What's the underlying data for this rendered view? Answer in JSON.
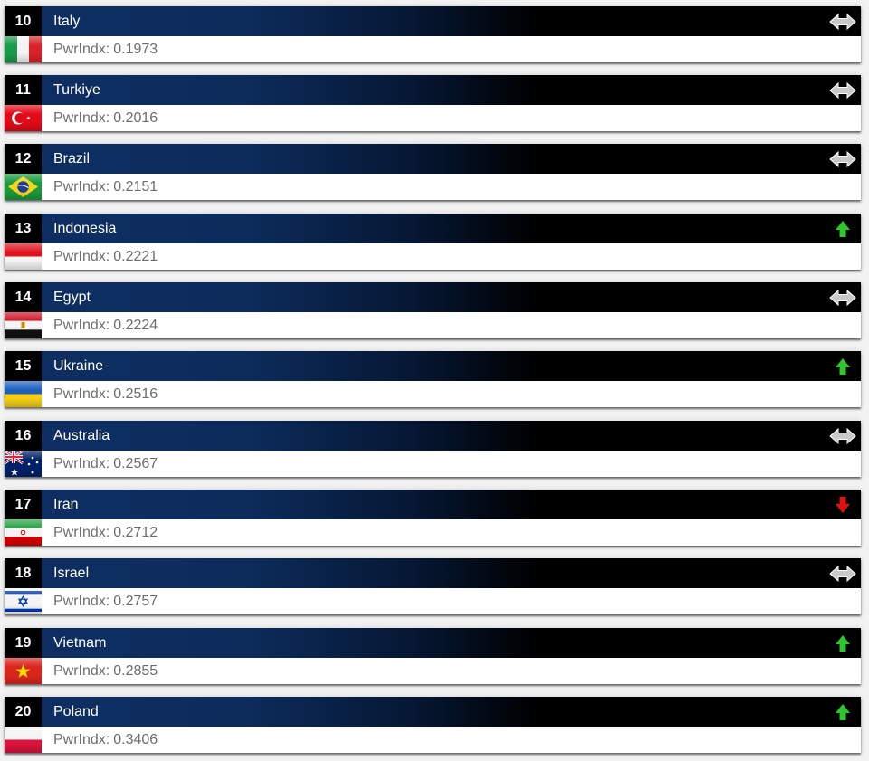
{
  "rankings": [
    {
      "rank": "10",
      "country": "Italy",
      "pwr_label": "PwrIndx:",
      "pwr_value": "0.1973",
      "trend": "same",
      "flag": "flag-italy"
    },
    {
      "rank": "11",
      "country": "Turkiye",
      "pwr_label": "PwrIndx:",
      "pwr_value": "0.2016",
      "trend": "same",
      "flag": "flag-turkiye"
    },
    {
      "rank": "12",
      "country": "Brazil",
      "pwr_label": "PwrIndx:",
      "pwr_value": "0.2151",
      "trend": "same",
      "flag": "flag-brazil"
    },
    {
      "rank": "13",
      "country": "Indonesia",
      "pwr_label": "PwrIndx:",
      "pwr_value": "0.2221",
      "trend": "up",
      "flag": "flag-indonesia"
    },
    {
      "rank": "14",
      "country": "Egypt",
      "pwr_label": "PwrIndx:",
      "pwr_value": "0.2224",
      "trend": "same",
      "flag": "flag-egypt"
    },
    {
      "rank": "15",
      "country": "Ukraine",
      "pwr_label": "PwrIndx:",
      "pwr_value": "0.2516",
      "trend": "up",
      "flag": "flag-ukraine"
    },
    {
      "rank": "16",
      "country": "Australia",
      "pwr_label": "PwrIndx:",
      "pwr_value": "0.2567",
      "trend": "same",
      "flag": "flag-australia"
    },
    {
      "rank": "17",
      "country": "Iran",
      "pwr_label": "PwrIndx:",
      "pwr_value": "0.2712",
      "trend": "down",
      "flag": "flag-iran"
    },
    {
      "rank": "18",
      "country": "Israel",
      "pwr_label": "PwrIndx:",
      "pwr_value": "0.2757",
      "trend": "same",
      "flag": "flag-israel"
    },
    {
      "rank": "19",
      "country": "Vietnam",
      "pwr_label": "PwrIndx:",
      "pwr_value": "0.2855",
      "trend": "up",
      "flag": "flag-vietnam"
    },
    {
      "rank": "20",
      "country": "Poland",
      "pwr_label": "PwrIndx:",
      "pwr_value": "0.3406",
      "trend": "up",
      "flag": "flag-poland"
    }
  ],
  "colors": {
    "trend_up": "#2ec52e",
    "trend_down": "#e01010",
    "trend_same": "#c8c8c8"
  },
  "icons": {
    "same": "left-right-arrow-icon",
    "up": "up-arrow-icon",
    "down": "down-arrow-icon"
  }
}
